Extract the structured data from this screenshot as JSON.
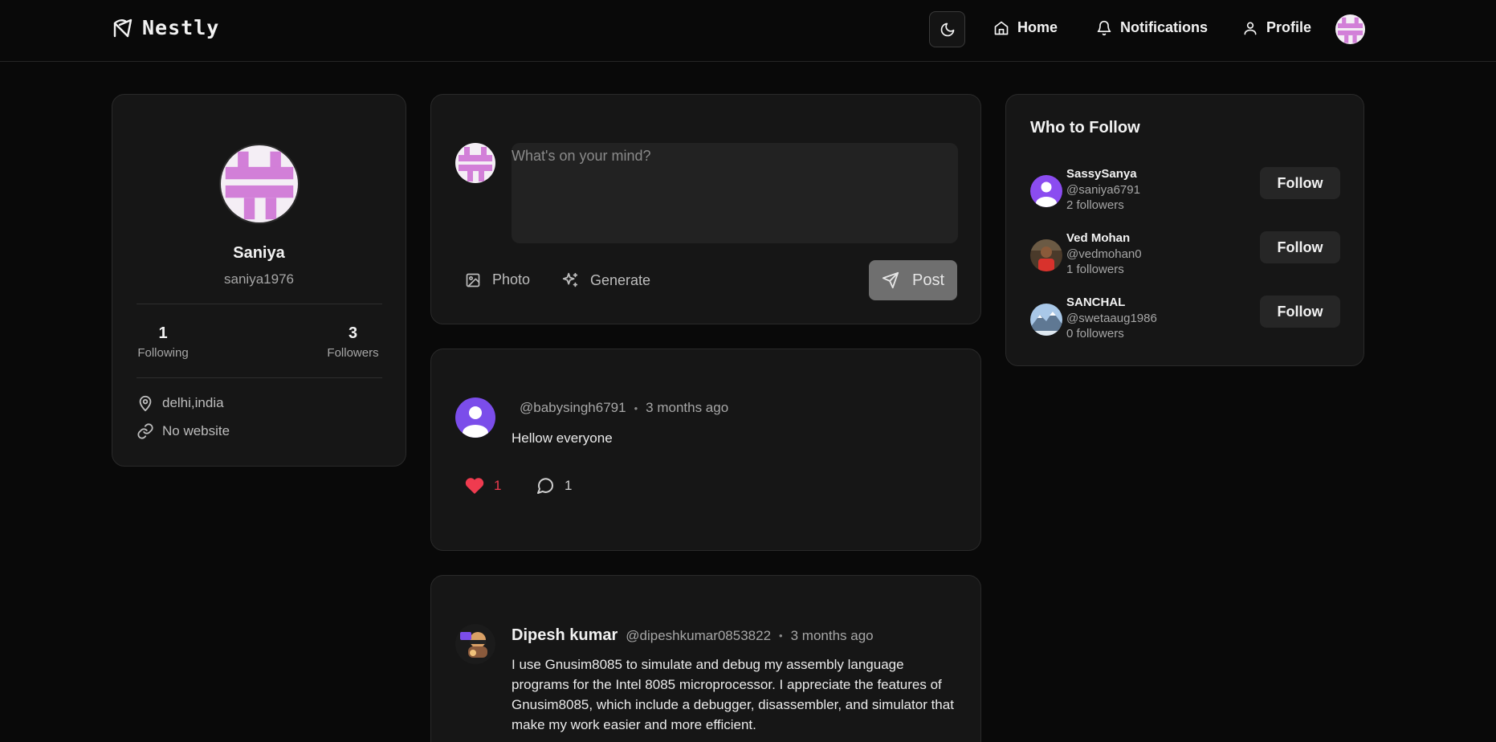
{
  "brand": {
    "name": "Nestly"
  },
  "nav": {
    "home": "Home",
    "notifications": "Notifications",
    "profile": "Profile"
  },
  "colors": {
    "accent_avatar": "#d27fd8",
    "like": "#ef3b4f",
    "background": "#090909",
    "card": "#161616"
  },
  "profile": {
    "name": "Saniya",
    "username": "saniya1976",
    "following_count": "1",
    "following_label": "Following",
    "followers_count": "3",
    "followers_label": "Followers",
    "location": "delhi,india",
    "website": "No website"
  },
  "composer": {
    "placeholder": "What's on your mind?",
    "photo_label": "Photo",
    "generate_label": "Generate",
    "post_label": "Post"
  },
  "posts": [
    {
      "author": "",
      "handle": "@babysingh6791",
      "time": "3 months ago",
      "content": "Hellow everyone",
      "likes": "1",
      "comments": "1"
    },
    {
      "author": "Dipesh kumar",
      "handle": "@dipeshkumar0853822",
      "time": "3 months ago",
      "content": "I use Gnusim8085 to simulate and debug my assembly language programs for the Intel 8085 microprocessor. I appreciate the features of Gnusim8085, which include a debugger, disassembler, and simulator that make my work easier and more efficient."
    }
  ],
  "who_to_follow": {
    "title": "Who to Follow",
    "follow_label": "Follow",
    "users": [
      {
        "name": "SassySanya",
        "handle": "@saniya6791",
        "followers": "2 followers"
      },
      {
        "name": "Ved Mohan",
        "handle": "@vedmohan0",
        "followers": "1 followers"
      },
      {
        "name": "SANCHAL",
        "handle": "@swetaaug1986",
        "followers": "0 followers"
      }
    ]
  }
}
